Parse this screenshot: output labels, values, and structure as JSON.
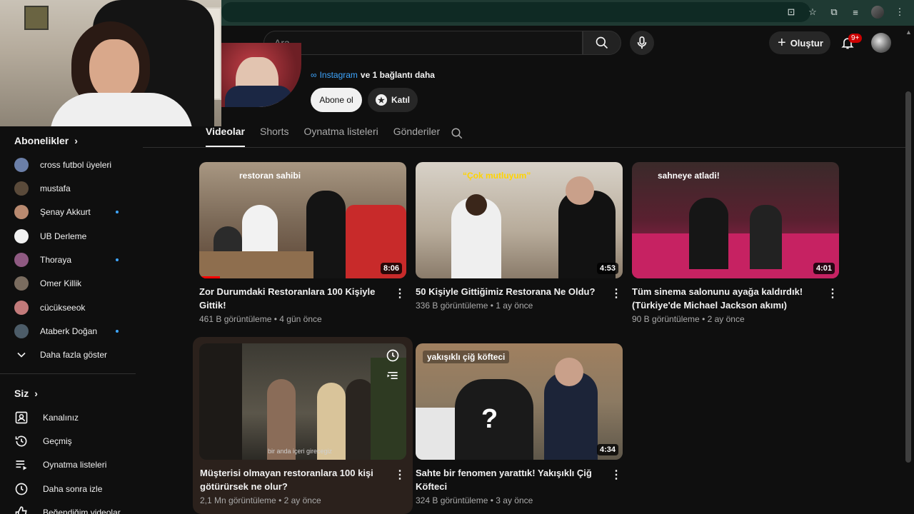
{
  "header": {
    "search_placeholder": "Ara",
    "create_label": "Oluştur",
    "notification_count": "9+"
  },
  "channel": {
    "link_label": "Instagram",
    "more_links": "ve 1 bağlantı daha",
    "subscribe_label": "Abone ol",
    "join_label": "Katıl"
  },
  "tabs": [
    {
      "label": "Videolar",
      "active": true
    },
    {
      "label": "Shorts",
      "active": false
    },
    {
      "label": "Oynatma listeleri",
      "active": false
    },
    {
      "label": "Gönderiler",
      "active": false
    }
  ],
  "sidebar": {
    "subscriptions_title": "Abonelikler",
    "subscriptions": [
      {
        "name": "cross futbol üyeleri",
        "dot": false,
        "color": "#6b7fa8"
      },
      {
        "name": "mustafa",
        "dot": false,
        "color": "#5a4a3a"
      },
      {
        "name": "Şenay Akkurt",
        "dot": true,
        "color": "#b98a70"
      },
      {
        "name": "UB Derleme",
        "dot": false,
        "color": "#f1f1f1"
      },
      {
        "name": "Thoraya",
        "dot": true,
        "color": "#8f5a82"
      },
      {
        "name": "Omer Killik",
        "dot": false,
        "color": "#7a6c5f"
      },
      {
        "name": "cücükseeok",
        "dot": false,
        "color": "#c27a7a"
      },
      {
        "name": "Ataberk Doğan",
        "dot": true,
        "color": "#4c5c68"
      }
    ],
    "show_more": "Daha fazla göster",
    "you_title": "Siz",
    "you_items": [
      {
        "label": "Kanalınız",
        "icon": "channel-icon"
      },
      {
        "label": "Geçmiş",
        "icon": "history-icon"
      },
      {
        "label": "Oynatma listeleri",
        "icon": "playlist-icon"
      },
      {
        "label": "Daha sonra izle",
        "icon": "watch-later-icon"
      },
      {
        "label": "Beğendiğim videolar",
        "icon": "like-icon"
      }
    ]
  },
  "videos": [
    {
      "title": "Zor Durumdaki Restoranlara 100 Kişiyle Gittik!",
      "views": "461 B görüntüleme",
      "age": "4 gün önce",
      "duration": "8:06",
      "caption": "restoran sahibi",
      "progress": 0.1
    },
    {
      "title": "50 Kişiyle Gittiğimiz Restorana Ne Oldu?",
      "views": "336 B görüntüleme",
      "age": "1 ay önce",
      "duration": "4:53",
      "caption": "“Çok mutluyum”",
      "progress": 0
    },
    {
      "title": "Tüm sinema salonunu ayağa kaldırdık! (Türkiye'de Michael Jackson akımı)",
      "views": "90 B görüntüleme",
      "age": "2 ay önce",
      "duration": "4:01",
      "caption": "sahneye atladi!",
      "progress": 0
    },
    {
      "title": "Müşterisi olmayan restoranlara 100 kişi götürürsek ne olur?",
      "views": "2,1 Mn görüntüleme",
      "age": "2 ay önce",
      "duration": "",
      "caption": "bir anda içeri girecegiz",
      "progress": 0
    },
    {
      "title": "Sahte bir fenomen yarattık! Yakışıklı Çiğ Köfteci",
      "views": "324 B görüntüleme",
      "age": "3 ay önce",
      "duration": "4:34",
      "caption": "yakışıklı çiğ köfteci",
      "progress": 0
    }
  ],
  "colors": {
    "accent_link": "#3ea6ff",
    "brand_red": "#ff0000",
    "caption_yellow": "#ffd400"
  }
}
